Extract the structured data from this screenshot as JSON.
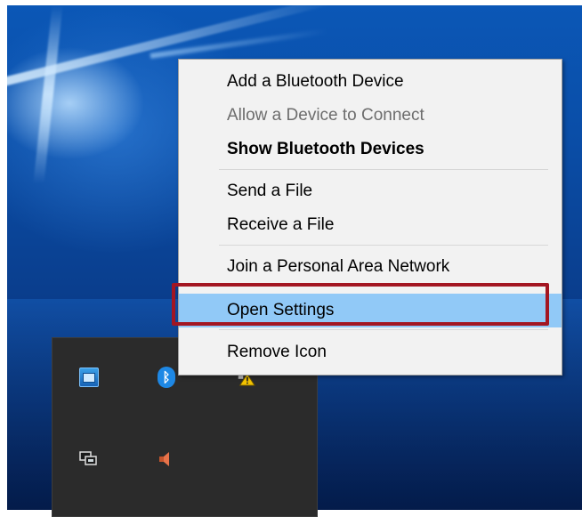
{
  "menu": {
    "items": [
      {
        "label": "Add a Bluetooth Device",
        "state": "normal"
      },
      {
        "label": "Allow a Device to Connect",
        "state": "disabled"
      },
      {
        "label": "Show Bluetooth Devices",
        "state": "bold"
      },
      {
        "label": "Send a File",
        "state": "normal"
      },
      {
        "label": "Receive a File",
        "state": "normal"
      },
      {
        "label": "Join a Personal Area Network",
        "state": "normal"
      },
      {
        "label": "Open Settings",
        "state": "selected"
      },
      {
        "label": "Remove Icon",
        "state": "normal"
      }
    ]
  },
  "tray": {
    "icons": [
      {
        "name": "intel-graphics-icon"
      },
      {
        "name": "bluetooth-icon",
        "glyph": "ᛒ"
      },
      {
        "name": "network-warning-icon"
      },
      {
        "name": "display-icon"
      },
      {
        "name": "speaker-icon"
      }
    ]
  },
  "colors": {
    "menu_background": "#f2f2f2",
    "selected_item": "#91c9f7",
    "highlight_border": "#a31622",
    "disabled_text": "#6d6d6d",
    "tray_background": "#2b2b2b"
  }
}
